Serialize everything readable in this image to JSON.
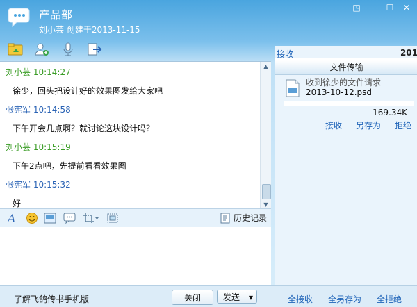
{
  "header": {
    "title": "产品部",
    "subtitle": "刘小芸 创建于2013-11-15"
  },
  "toolbar": {
    "icons": [
      "folder-share-icon",
      "add-user-icon",
      "microphone-icon",
      "exit-icon"
    ]
  },
  "chat": {
    "messages": [
      {
        "sender": "刘小芸",
        "time": "10:14:27",
        "text": "徐少，回头把设计好的效果图发给大家吧",
        "color": "#3a9c25"
      },
      {
        "sender": "张宪军",
        "time": "10:14:58",
        "text": "下午开会几点啊？就讨论这块设计吗？",
        "color": "#2a63b5"
      },
      {
        "sender": "刘小芸",
        "time": "10:15:19",
        "text": "下午2点吧，先提前看看效果图",
        "color": "#3a9c25"
      },
      {
        "sender": "张宪军",
        "time": "10:15:32",
        "text": "好",
        "color": "#2a63b5"
      }
    ]
  },
  "format_bar": {
    "history_label": "历史记录"
  },
  "right_panel": {
    "tab_left": "接收",
    "tab_right": "201",
    "title": "文件传输",
    "request": "收到徐少的文件请求",
    "filename": "2013-10-12.psd",
    "progress_fraction": 0.0,
    "size": "169.34K",
    "actions": {
      "receive": "接收",
      "save_as": "另存为",
      "reject": "拒绝"
    }
  },
  "bottom": {
    "mobile_label": "了解飞鸽传书手机版",
    "close_label": "关闭",
    "send_label": "发送",
    "receive_all": "全接收",
    "save_all": "全另存为",
    "reject_all": "全拒绝"
  }
}
